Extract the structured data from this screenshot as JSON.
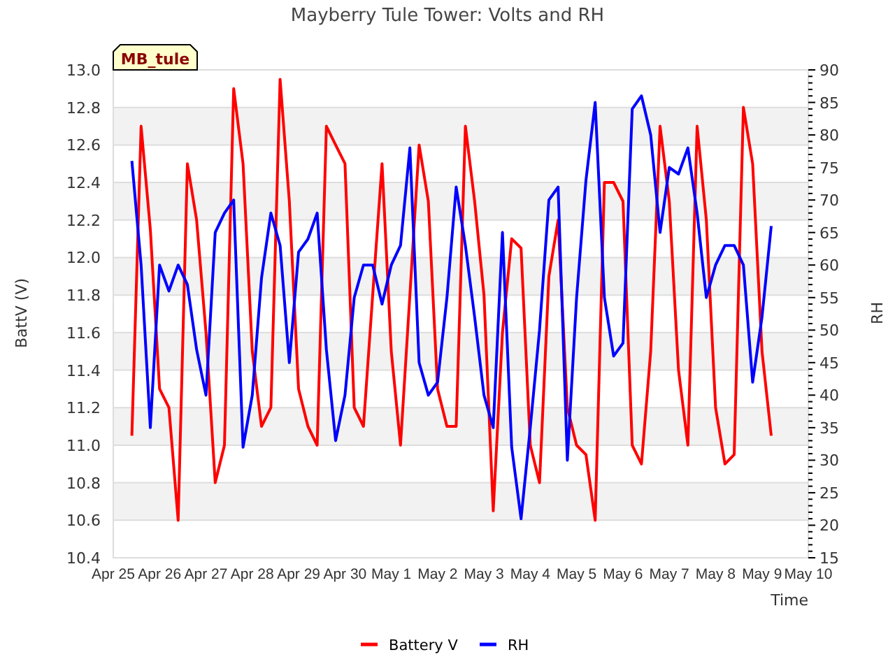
{
  "chart": {
    "badge": "MB_tule",
    "chart_data": {
      "type": "line",
      "title": "Mayberry Tule Tower: Volts and RH",
      "xlabel": "Time",
      "ylabel": "BattV (V)",
      "y2label": "RH",
      "categories": [
        "Apr 25",
        null,
        null,
        null,
        null,
        "Apr 26",
        null,
        null,
        null,
        null,
        "Apr 27",
        null,
        null,
        null,
        null,
        "Apr 28",
        null,
        null,
        null,
        null,
        "Apr 29",
        null,
        null,
        null,
        null,
        "Apr 30",
        null,
        null,
        null,
        null,
        "May 1",
        null,
        null,
        null,
        null,
        "May 2",
        null,
        null,
        null,
        null,
        "May 3",
        null,
        null,
        null,
        null,
        "May 4",
        null,
        null,
        null,
        null,
        "May 5",
        null,
        null,
        null,
        null,
        "May 6",
        null,
        null,
        null,
        null,
        "May 7",
        null,
        null,
        null,
        null,
        "May 8",
        null,
        null,
        null,
        null,
        "May 9",
        null,
        null,
        null,
        null,
        "May 10"
      ],
      "series": [
        {
          "name": "Battery V",
          "color": "#ff0000",
          "values": [
            null,
            null,
            11.05,
            12.7,
            12.15,
            11.3,
            11.2,
            10.6,
            12.5,
            12.2,
            11.6,
            10.8,
            11.0,
            12.9,
            12.5,
            11.5,
            11.1,
            11.2,
            12.95,
            12.3,
            11.3,
            11.1,
            11.0,
            12.7,
            12.6,
            12.5,
            11.2,
            11.1,
            11.8,
            12.5,
            11.5,
            11.0,
            11.8,
            12.6,
            12.3,
            11.3,
            11.1,
            11.1,
            12.7,
            12.3,
            11.8,
            10.65,
            11.6,
            12.1,
            12.05,
            11.0,
            10.8,
            11.9,
            12.2,
            11.2,
            11.0,
            10.95,
            10.6,
            12.4,
            12.4,
            12.3,
            11.0,
            10.9,
            11.5,
            12.7,
            12.3,
            11.4,
            11.0,
            12.7,
            12.2,
            11.2,
            10.9,
            10.95,
            12.8,
            12.5,
            11.5,
            11.05,
            null,
            null,
            null,
            null
          ]
        },
        {
          "name": "RH",
          "color": "#0000ff",
          "axis": "y2",
          "values": [
            null,
            null,
            76,
            60,
            35,
            60,
            56,
            60,
            57,
            47,
            40,
            65,
            68,
            70,
            32,
            40,
            58,
            68,
            63,
            45,
            62,
            64,
            68,
            47,
            33,
            40,
            55,
            60,
            60,
            54,
            60,
            63,
            78,
            45,
            40,
            42,
            55,
            72,
            63,
            52,
            40,
            35,
            65,
            32,
            21,
            35,
            50,
            70,
            72,
            30,
            55,
            73,
            85,
            55,
            46,
            48,
            84,
            86,
            80,
            65,
            75,
            74,
            78,
            68,
            55,
            60,
            63,
            63,
            60,
            42,
            52,
            66,
            null,
            null,
            null,
            null
          ]
        }
      ],
      "grid": true,
      "legend": "bottom",
      "ylim": [
        10.4,
        13.0
      ],
      "y2lim": [
        15,
        90
      ],
      "yticks": [
        {
          "value": 10.4,
          "label": "10.4"
        },
        {
          "value": 10.6,
          "label": "10.6"
        },
        {
          "value": 10.8,
          "label": "10.8"
        },
        {
          "value": 11.0,
          "label": "11.0"
        },
        {
          "value": 11.2,
          "label": "11.2"
        },
        {
          "value": 11.4,
          "label": "11.4"
        },
        {
          "value": 11.6,
          "label": "11.6"
        },
        {
          "value": 11.8,
          "label": "11.8"
        },
        {
          "value": 12.0,
          "label": "12.0"
        },
        {
          "value": 12.2,
          "label": "12.2"
        },
        {
          "value": 12.4,
          "label": "12.4"
        },
        {
          "value": 12.6,
          "label": "12.6"
        },
        {
          "value": 12.8,
          "label": "12.8"
        },
        {
          "value": 13.0,
          "label": "13.0"
        }
      ],
      "y2ticks": [
        15,
        20,
        25,
        30,
        35,
        40,
        45,
        50,
        55,
        60,
        65,
        70,
        75,
        80,
        85,
        90
      ]
    }
  }
}
